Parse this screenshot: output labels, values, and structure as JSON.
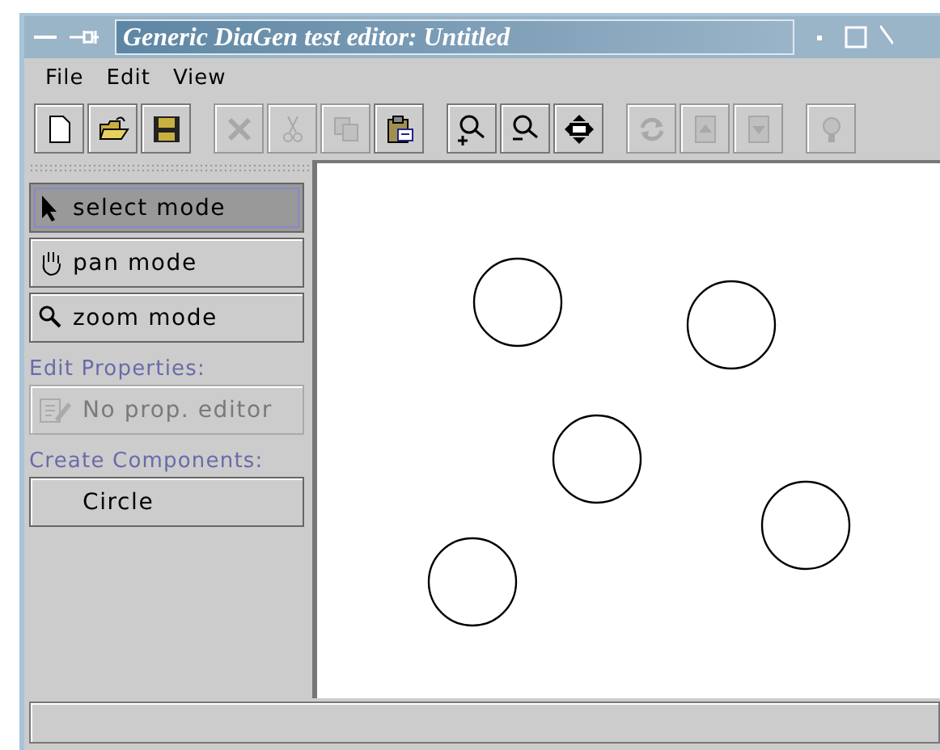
{
  "window": {
    "title": "Generic DiaGen test editor: Untitled"
  },
  "menu": [
    "File",
    "Edit",
    "View"
  ],
  "toolbar": [
    [
      {
        "kind": "new",
        "disabled": false
      },
      {
        "kind": "open",
        "disabled": false
      },
      {
        "kind": "save",
        "disabled": false
      }
    ],
    [
      {
        "kind": "delete",
        "disabled": true
      },
      {
        "kind": "cut",
        "disabled": true
      },
      {
        "kind": "copy",
        "disabled": true
      },
      {
        "kind": "paste",
        "disabled": false
      }
    ],
    [
      {
        "kind": "zoom-in",
        "disabled": false
      },
      {
        "kind": "zoom-out",
        "disabled": false
      },
      {
        "kind": "move",
        "disabled": false
      }
    ],
    [
      {
        "kind": "refresh",
        "disabled": true
      },
      {
        "kind": "up",
        "disabled": true
      },
      {
        "kind": "down",
        "disabled": true
      }
    ],
    [
      {
        "kind": "bulb",
        "disabled": true
      }
    ]
  ],
  "modes": [
    {
      "kind": "select",
      "label": "select mode",
      "selected": true
    },
    {
      "kind": "pan",
      "label": "pan mode",
      "selected": false
    },
    {
      "kind": "zoom",
      "label": "zoom mode",
      "selected": false
    }
  ],
  "edit_properties": {
    "heading": "Edit Properties:",
    "button": {
      "label": "No prop. editor",
      "disabled": true
    }
  },
  "create_components": {
    "heading": "Create Components:",
    "items": [
      {
        "label": "Circle"
      }
    ]
  }
}
